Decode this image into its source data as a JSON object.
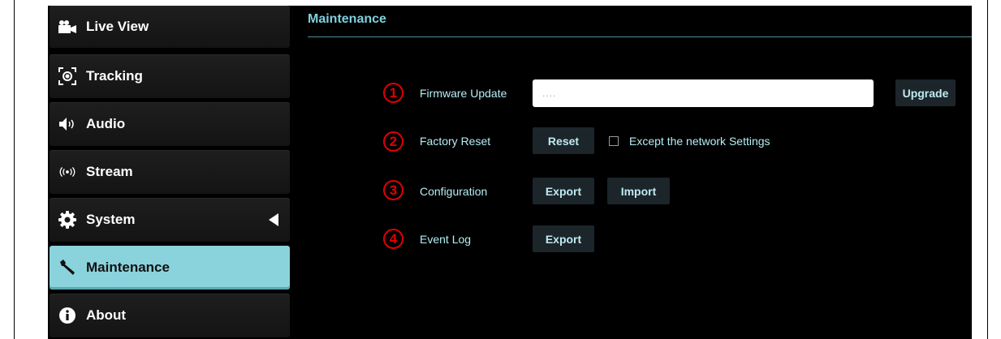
{
  "sidebar": {
    "items": [
      {
        "label": "Live View",
        "icon": "video-camera-icon"
      },
      {
        "label": "Tracking",
        "icon": "tracking-target-icon"
      },
      {
        "label": "Audio",
        "icon": "speaker-icon"
      },
      {
        "label": "Stream",
        "icon": "broadcast-icon"
      },
      {
        "label": "System",
        "icon": "gear-icon"
      },
      {
        "label": "Maintenance",
        "icon": "wrench-icon",
        "active": true
      },
      {
        "label": "About",
        "icon": "info-icon"
      }
    ]
  },
  "main": {
    "title": "Maintenance",
    "firmware": {
      "number": "1",
      "label": "Firmware Update",
      "placeholder": "....",
      "upgrade_label": "Upgrade"
    },
    "factory_reset": {
      "number": "2",
      "label": "Factory Reset",
      "reset_label": "Reset",
      "except_label": "Except the network Settings",
      "except_checked": false
    },
    "configuration": {
      "number": "3",
      "label": "Configuration",
      "export_label": "Export",
      "import_label": "Import"
    },
    "event_log": {
      "number": "4",
      "label": "Event Log",
      "export_label": "Export"
    }
  },
  "colors": {
    "accent": "#8ad3dc",
    "title": "#7fd0de",
    "label": "#b5eef4",
    "marker": "#e00000",
    "background": "#000000"
  }
}
